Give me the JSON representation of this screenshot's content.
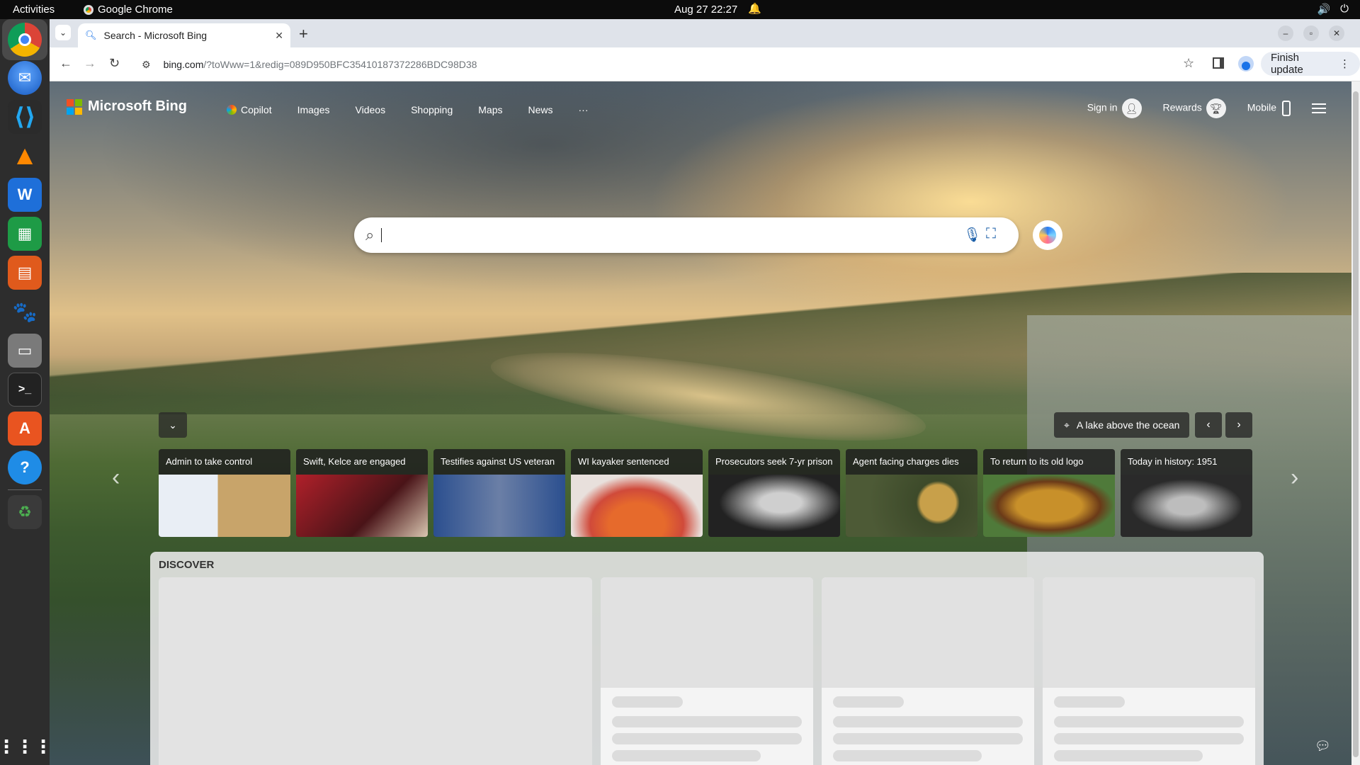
{
  "system_bar": {
    "activities": "Activities",
    "app_name": "Google Chrome",
    "clock": "Aug 27  22:27"
  },
  "browser": {
    "tab_title": "Search - Microsoft Bing",
    "url_host": "bing.com",
    "url_path": "/?toWww=1&redig=089D950BFC35410187372286BDC98D38",
    "update_label": "Finish update"
  },
  "bing": {
    "logo_text": "Microsoft Bing",
    "nav": [
      "Copilot",
      "Images",
      "Videos",
      "Shopping",
      "Maps",
      "News",
      "···"
    ],
    "sign_in": "Sign in",
    "rewards": "Rewards",
    "mobile": "Mobile",
    "search_value": "",
    "location_label": "A lake above the ocean",
    "news": [
      {
        "title": "Admin to take control"
      },
      {
        "title": "Swift, Kelce are engaged"
      },
      {
        "title": "Testifies against US veteran"
      },
      {
        "title": "WI kayaker sentenced"
      },
      {
        "title": "Prosecutors seek 7-yr prison"
      },
      {
        "title": "Agent facing charges dies"
      },
      {
        "title": "To return to its old logo"
      },
      {
        "title": "Today in history: 1951"
      }
    ],
    "discover_label": "DISCOVER"
  },
  "colors": {
    "ms_red": "#f25022",
    "ms_green": "#7fba00",
    "ms_blue": "#00a4ef",
    "ms_yellow": "#ffb900",
    "chrome_blue": "#1a73e8"
  }
}
